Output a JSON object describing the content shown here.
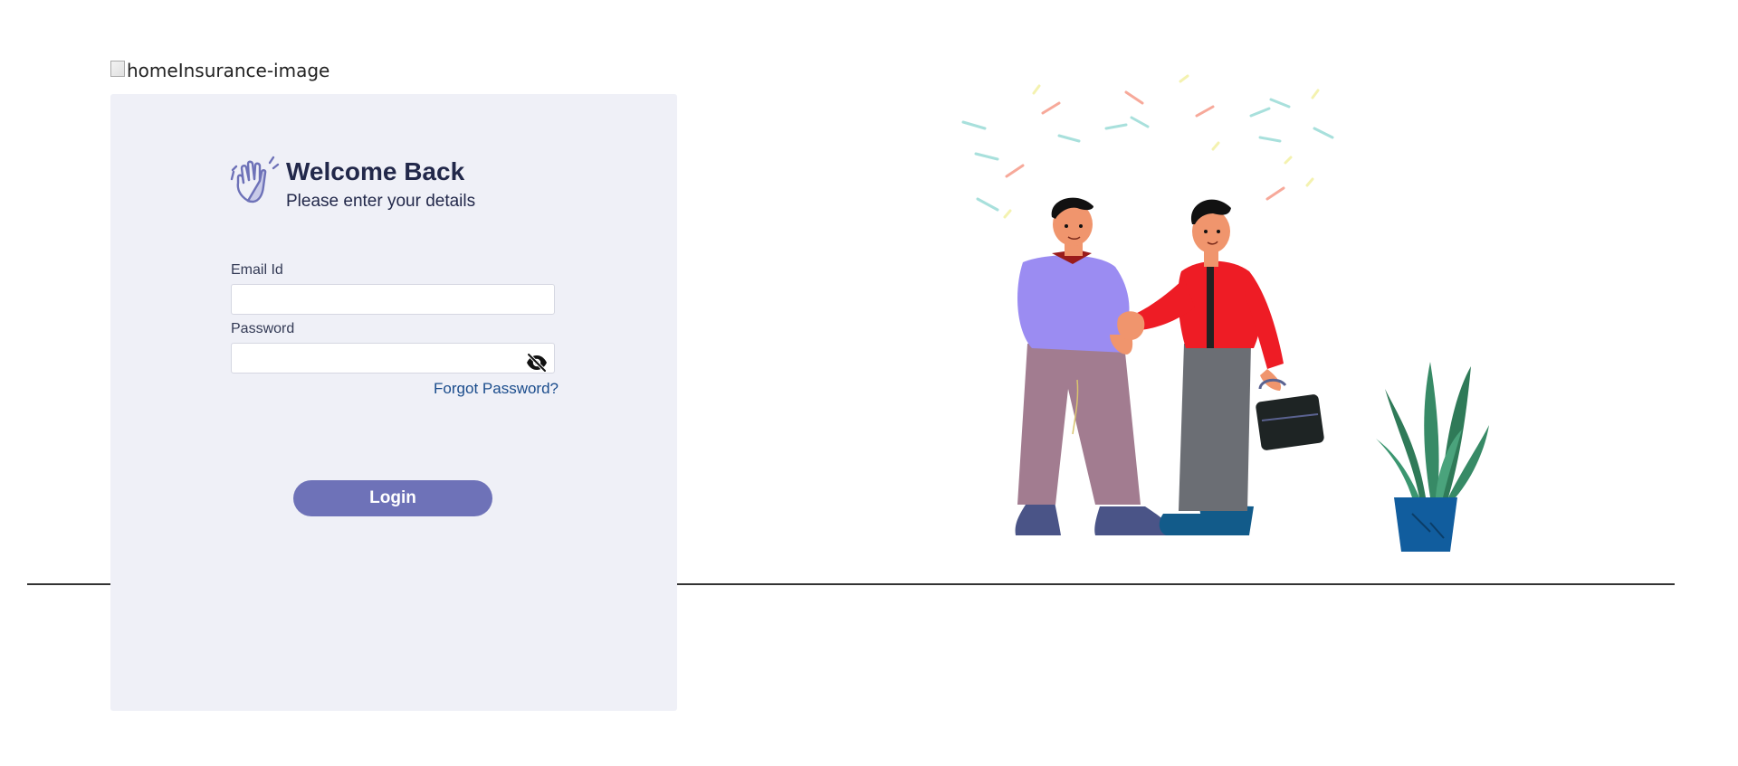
{
  "header": {
    "broken_image_alt": "homeInsurance-image"
  },
  "login": {
    "title": "Welcome Back",
    "subtitle": "Please enter your details",
    "email_label": "Email Id",
    "email_value": "",
    "password_label": "Password",
    "password_value": "",
    "password_toggle_icon": "eye-slash-icon",
    "forgot_password": "Forgot Password?",
    "login_button": "Login"
  },
  "colors": {
    "card_background": "#eff0f7",
    "primary_button": "#6e72b8",
    "heading_text": "#22284a",
    "link_text": "#1a4c8c"
  },
  "icons": {
    "welcome": "waving-hand-icon",
    "illustration": "handshake-illustration"
  }
}
